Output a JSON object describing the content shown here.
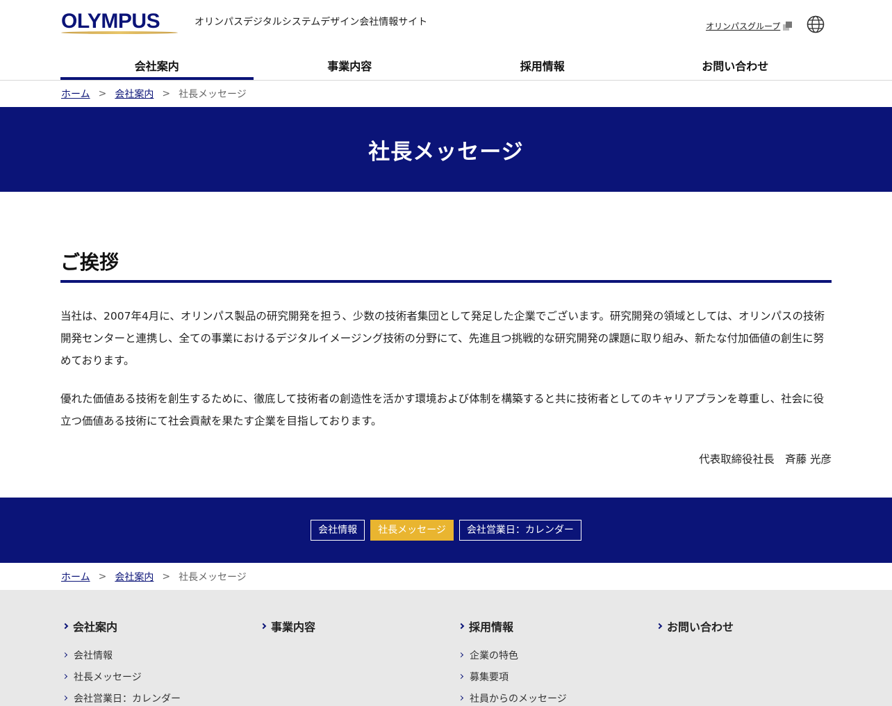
{
  "header": {
    "logo_text": "OLYMPUS",
    "site_name": "オリンパスデジタルシステムデザイン会社情報サイト",
    "group_link": "オリンパスグループ",
    "globe_icon": "globe-icon"
  },
  "gnav": {
    "items": [
      "会社案内",
      "事業内容",
      "採用情報",
      "お問い合わせ"
    ],
    "active_index": 0
  },
  "breadcrumb": {
    "home": "ホーム",
    "company": "会社案内",
    "current": "社長メッセージ",
    "separator": ">"
  },
  "hero": {
    "title": "社長メッセージ"
  },
  "main": {
    "section_title": "ご挨拶",
    "paragraphs": [
      "当社は、2007年4月に、オリンパス製品の研究開発を担う、少数の技術者集団として発足した企業でございます。研究開発の領域としては、オリンパスの技術開発センターと連携し、全ての事業におけるデジタルイメージング技術の分野にて、先進且つ挑戦的な研究開発の課題に取り組み、新たな付加価値の創生に努めております。",
      "優れた価値ある技術を創生するために、徹底して技術者の創造性を活かす環境および体制を構築すると共に技術者としてのキャリアプランを尊重し、社会に役立つ価値ある技術にて社会貢献を果たす企業を目指しております。"
    ],
    "signature": "代表取締役社長　斉藤 光彦"
  },
  "localnav": {
    "buttons": [
      "会社情報",
      "社長メッセージ",
      "会社営業日：カレンダー"
    ],
    "active_index": 1
  },
  "footer": {
    "columns": [
      {
        "heading": "会社案内",
        "items": [
          "会社情報",
          "社長メッセージ",
          "会社営業日：カレンダー"
        ]
      },
      {
        "heading": "事業内容",
        "items": []
      },
      {
        "heading": "採用情報",
        "items": [
          "企業の特色",
          "募集要項",
          "社員からのメッセージ"
        ]
      },
      {
        "heading": "お問い合わせ",
        "items": []
      }
    ]
  },
  "colors": {
    "brand_navy": "#0b1478",
    "accent_gold": "#e9b530",
    "footer_bg": "#e8e8e8"
  }
}
